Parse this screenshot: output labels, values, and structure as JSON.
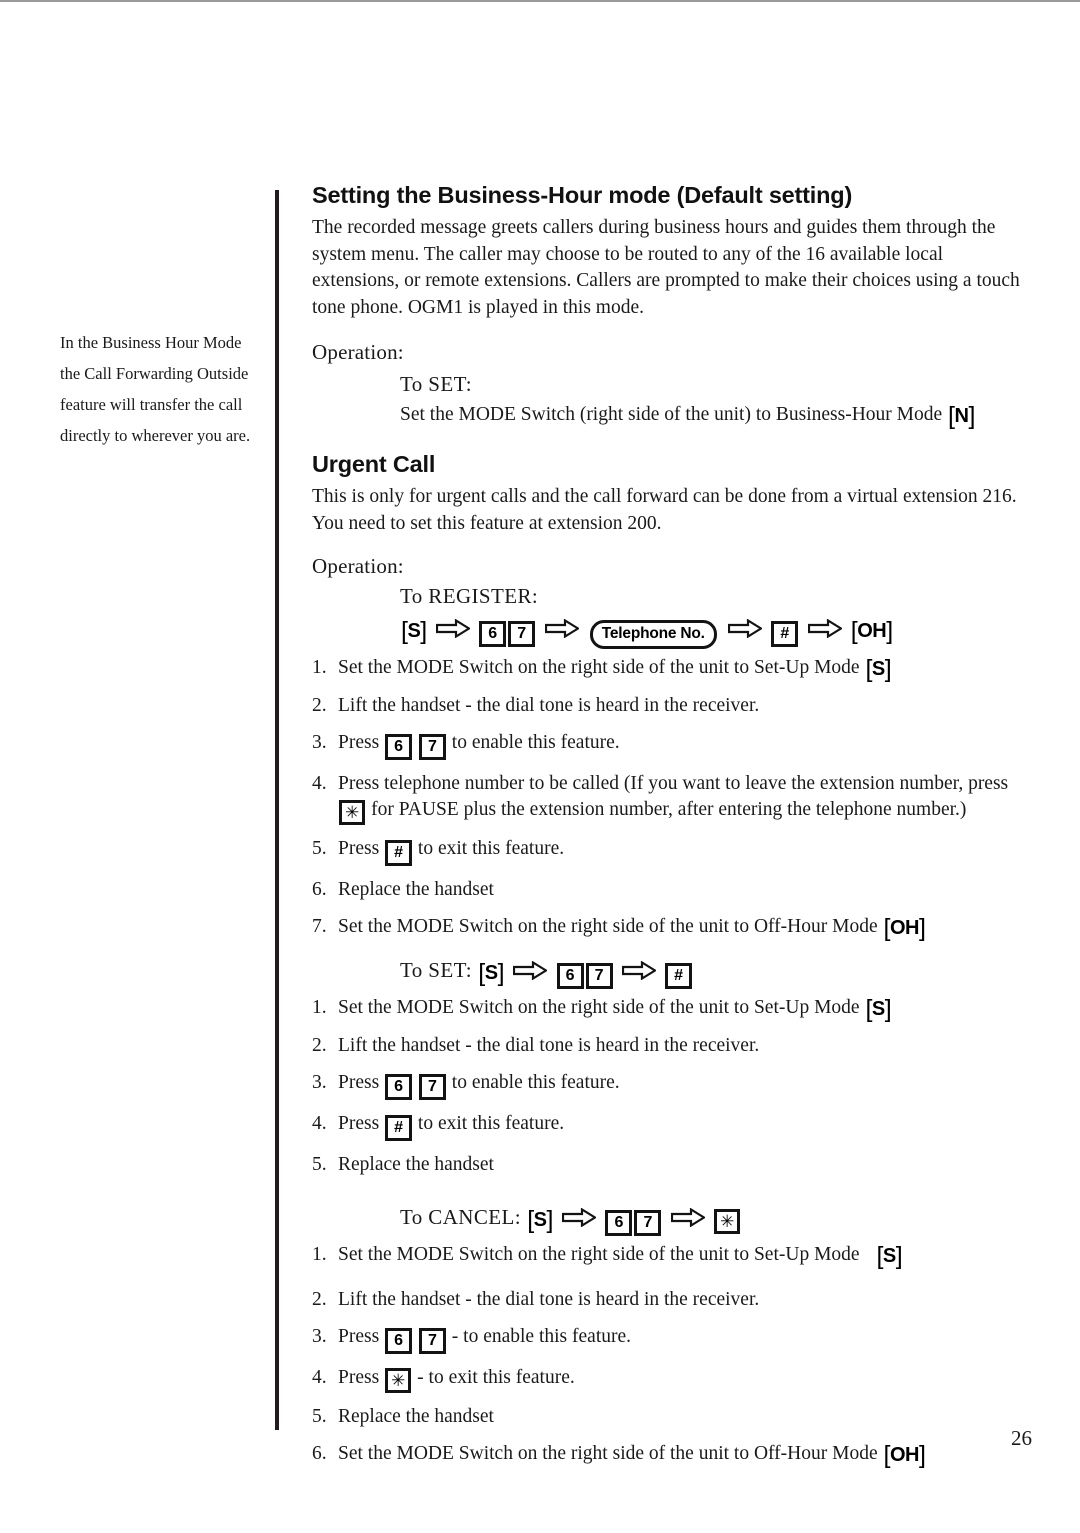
{
  "page": {
    "number": "26"
  },
  "margin_note": {
    "lines": [
      "In the Business Hour Mode",
      "the Call Forwarding Outside",
      "feature will transfer the call",
      "directly to wherever you are."
    ]
  },
  "business_hour": {
    "heading": "Setting the Business-Hour mode (Default setting)",
    "body": "The recorded message greets callers during business hours and guides them through the system menu. The caller may choose to be routed to any of the 16 available local extensions, or remote extensions. Callers are prompted to make their choices using a touch tone phone. OGM1 is played in this mode.",
    "operation_label": "Operation:",
    "to_set_label": "To SET:",
    "set_instruction_prefix": "Set the MODE Switch (right side of the unit) to Business-Hour Mode",
    "set_mode_key": "N"
  },
  "urgent_call": {
    "heading": "Urgent Call",
    "body": "This is only for urgent calls and the call forward can be done from a virtual extension 216. You need to set this feature at extension 200.",
    "operation_label": "Operation:",
    "register": {
      "label": "To REGISTER:",
      "sequence": {
        "start_key": "S",
        "digit1": "6",
        "digit2": "7",
        "telephone_button": "Telephone No.",
        "hash_key": "#",
        "end_key": "OH"
      },
      "steps": [
        {
          "num": "1.",
          "text": "Set the MODE Switch on the right side of the unit to Set-Up Mode",
          "trailing_key": "S"
        },
        {
          "num": "2.",
          "text": "Lift the handset - the dial tone is heard in the receiver."
        },
        {
          "num": "3.",
          "press_label": "Press",
          "key1": "6",
          "key2": "7",
          "tail": "to enable this feature."
        },
        {
          "num": "4.",
          "part1": "Press telephone number to be called (If you want to leave the extension number, press",
          "star_key": "✳",
          "part2": "for PAUSE plus the extension number, after entering the telephone number.)"
        },
        {
          "num": "5.",
          "press_label": "Press",
          "key1": "#",
          "tail": "to exit this feature."
        },
        {
          "num": "6.",
          "text": "Replace the handset"
        },
        {
          "num": "7.",
          "text": "Set the MODE Switch on the right side of the unit to Off-Hour Mode",
          "trailing_key": "OH"
        }
      ]
    },
    "set": {
      "label": "To SET:",
      "sequence": {
        "start_key": "S",
        "digit1": "6",
        "digit2": "7",
        "end_key": "#"
      },
      "steps": [
        {
          "num": "1.",
          "text": "Set the MODE Switch on the right side of the unit to Set-Up Mode",
          "trailing_key": "S"
        },
        {
          "num": "2.",
          "text": "Lift the handset - the dial tone is heard in the receiver."
        },
        {
          "num": "3.",
          "press_label": "Press",
          "key1": "6",
          "key2": "7",
          "tail": "to enable this feature."
        },
        {
          "num": "4.",
          "press_label": "Press",
          "key1": "#",
          "tail": "to exit this feature."
        },
        {
          "num": "5.",
          "text": "Replace the handset"
        }
      ]
    },
    "cancel": {
      "label": "To CANCEL:",
      "sequence": {
        "start_key": "S",
        "digit1": "6",
        "digit2": "7",
        "end_key": "✳"
      },
      "steps": [
        {
          "num": "1.",
          "text": "Set the MODE Switch on the right side of the unit to Set-Up Mode",
          "trailing_key": "S"
        },
        {
          "num": "2.",
          "text": "Lift the handset - the dial tone is heard in the receiver."
        },
        {
          "num": "3.",
          "press_label": "Press",
          "key1": "6",
          "key2": "7",
          "tail": "- to enable this feature."
        },
        {
          "num": "4.",
          "press_label": "Press",
          "key1": "✳",
          "tail": "- to exit this feature."
        },
        {
          "num": "5.",
          "text": "Replace the handset"
        },
        {
          "num": "6.",
          "text": "Set the MODE Switch on the right side of the unit to Off-Hour Mode",
          "trailing_key": "OH"
        }
      ]
    }
  }
}
